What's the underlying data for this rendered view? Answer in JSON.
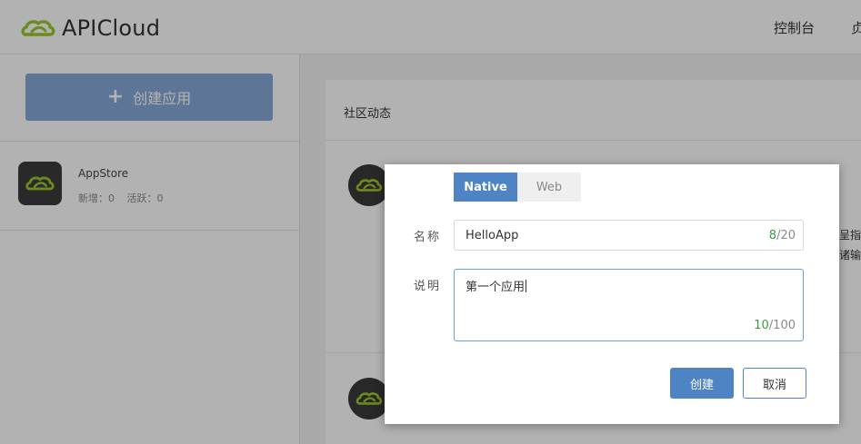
{
  "header": {
    "logo_text": "APICloud",
    "links": [
      "控制台",
      "贞"
    ]
  },
  "sidebar": {
    "create_button": {
      "label": "创建应用",
      "icon": "plus-icon"
    },
    "apps": [
      {
        "name": "AppStore",
        "new_label": "新增：0",
        "active_label": "活跃：0",
        "icon": "apicloud-logo-icon"
      }
    ]
  },
  "main": {
    "card_title": "社区动态",
    "feed_snippets": [
      "呈指令",
      "诸输入"
    ]
  },
  "modal": {
    "tabs": [
      {
        "label": "Native",
        "active": true
      },
      {
        "label": "Web",
        "active": false
      }
    ],
    "name": {
      "label": "名称",
      "value": "HelloApp",
      "count": "8",
      "max": "/20"
    },
    "description": {
      "label": "说明",
      "value": "第一个应用",
      "count": "10",
      "max": "/100"
    },
    "buttons": {
      "create": "创建",
      "cancel": "取消"
    }
  },
  "colors": {
    "accent": "#4f84c4",
    "logo_green": "#9cc62c",
    "counter_green": "#3d9a3d",
    "overlay": "rgba(0,0,0,0.30)"
  }
}
